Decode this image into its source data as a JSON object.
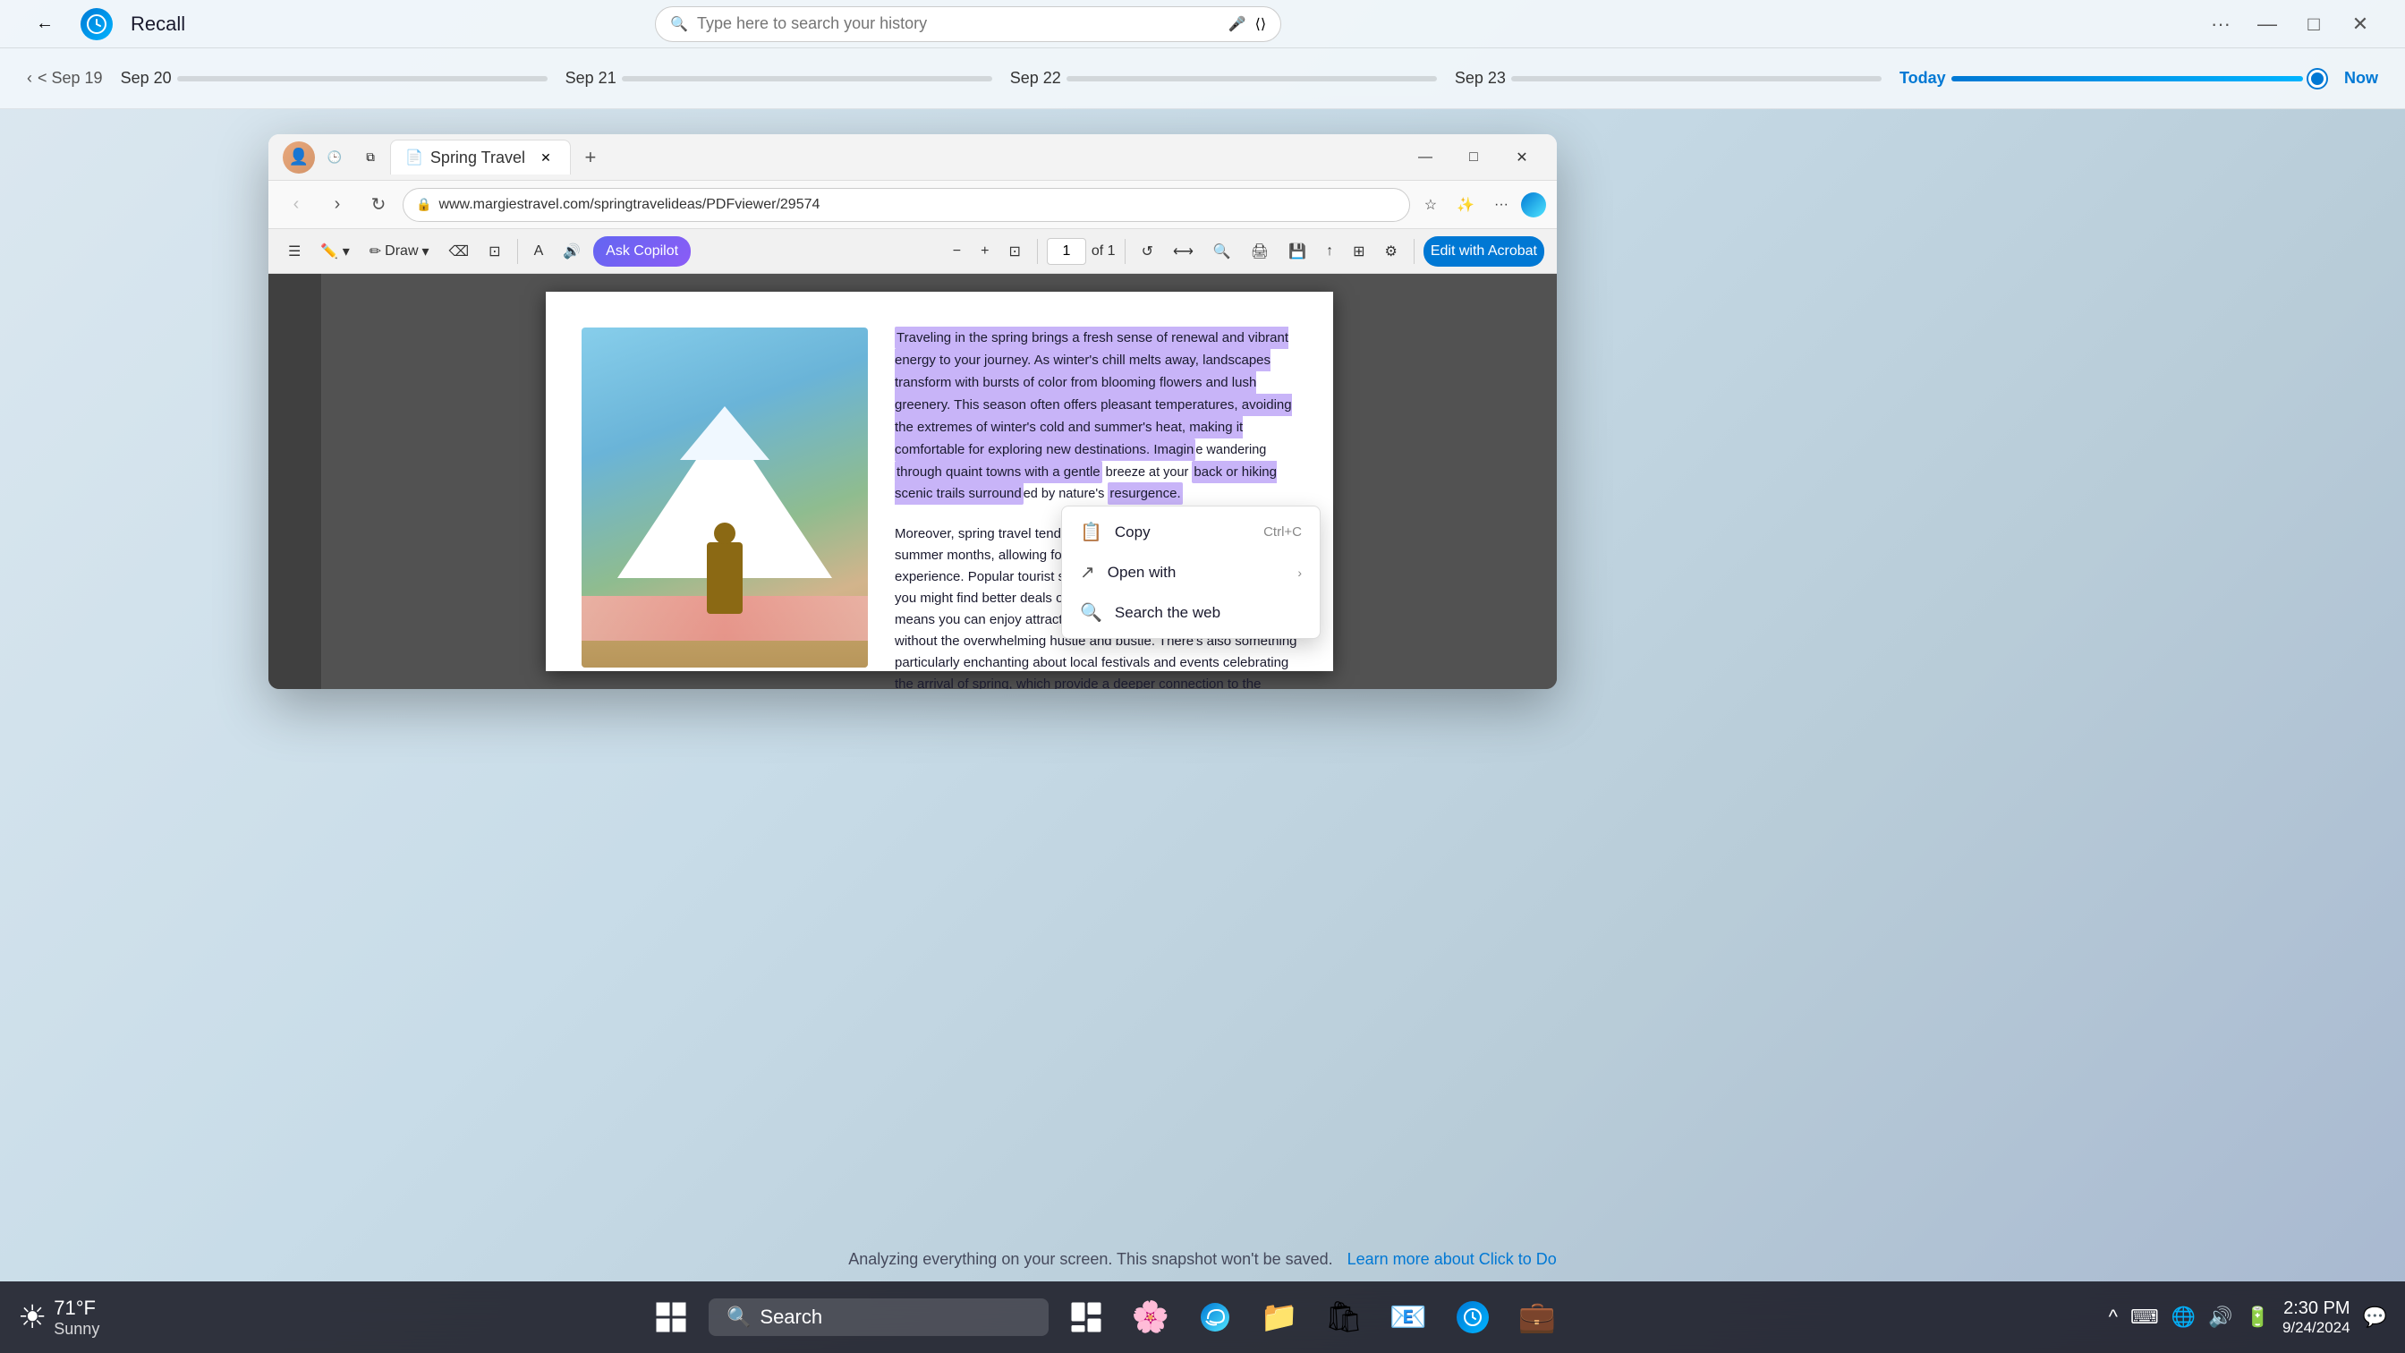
{
  "app": {
    "title": "Recall"
  },
  "recall_bar": {
    "back_label": "←",
    "title": "Recall",
    "search_placeholder": "Type here to search your history"
  },
  "timeline": {
    "nav_label": "< Sep 19",
    "segments": [
      {
        "label": "Sep 19",
        "active": false
      },
      {
        "label": "Sep 20",
        "active": false
      },
      {
        "label": "Sep 21",
        "active": false
      },
      {
        "label": "Sep 22",
        "active": false
      },
      {
        "label": "Sep 23",
        "active": false
      },
      {
        "label": "Today",
        "active": true
      }
    ],
    "now_label": "Now"
  },
  "browser": {
    "tab_label": "Spring Travel",
    "tab_favicon": "📄",
    "url": "www.margiestravel.com/springtravelideas/PDFviewer/29574",
    "window_title": "Spring Travel"
  },
  "pdf_toolbar": {
    "page_current": "1",
    "page_total": "of 1",
    "copilot_label": "Ask Copilot",
    "draw_label": "Draw",
    "edit_label": "Edit with Acrobat"
  },
  "pdf_content": {
    "highlighted_text": "Traveling in the spring brings a fresh sense of renewal and vibrant energy to your journey. As winter's chill melts away, landscapes transform with bursts of color from blooming flowers and lush greenery. This season often offers pleasant temperatures, avoiding the extremes of winter's cold and summer's heat, making it comfortable for exploring new destinations. Imagin",
    "highlighted_text2": "through quaint towns with a gentle",
    "highlighted_text3": "back or hiking scenic trails surround",
    "highlighted_text4": "resurgence.",
    "normal_text": "Moreover, spring travel tends to be less crowded than the peak summer months, allowing for a more relaxed and intimate experience. Popular tourist spots are often more accessible, and you might find better deals on accommodations and flights. This means you can enjoy attractions, museums, and natural wonders without the overwhelming hustle and bustle. There's also something particularly enchanting about local festivals and events celebrating the arrival of spring, which provide a deeper connection to the culture and traditions of the place you're visiting."
  },
  "context_menu": {
    "items": [
      {
        "icon": "📋",
        "label": "Copy",
        "shortcut": "Ctrl+C"
      },
      {
        "icon": "↗",
        "label": "Open with",
        "has_submenu": true,
        "shortcut": ""
      },
      {
        "icon": "🔍",
        "label": "Search the web",
        "shortcut": ""
      }
    ]
  },
  "status_bar": {
    "text": "Analyzing everything on your screen. This snapshot won't be saved.",
    "link_text": "Learn more about Click to Do"
  },
  "taskbar": {
    "search_placeholder": "Search",
    "weather_temp": "71°F",
    "weather_desc": "Sunny",
    "clock_time": "2:30 PM",
    "clock_date": "9/24/2024",
    "taskbar_icons": [
      {
        "name": "windows-icon",
        "emoji": "⊞"
      },
      {
        "name": "search-icon",
        "emoji": "🔍"
      },
      {
        "name": "taskview-icon",
        "emoji": "❑"
      },
      {
        "name": "edge-icon",
        "emoji": "🌐"
      },
      {
        "name": "files-icon",
        "emoji": "📁"
      },
      {
        "name": "store-icon",
        "emoji": "🛍"
      },
      {
        "name": "teams-icon",
        "emoji": "💬"
      }
    ]
  }
}
